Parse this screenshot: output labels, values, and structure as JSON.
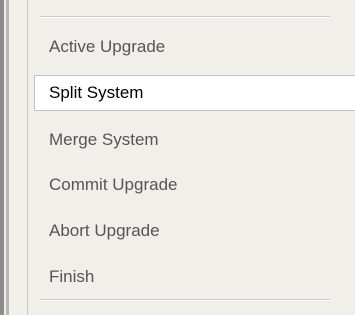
{
  "wizard": {
    "steps": [
      {
        "label": "Active Upgrade",
        "selected": false
      },
      {
        "label": "Split System",
        "selected": true
      },
      {
        "label": "Merge System",
        "selected": false
      },
      {
        "label": "Commit Upgrade",
        "selected": false
      },
      {
        "label": "Abort Upgrade",
        "selected": false
      },
      {
        "label": "Finish",
        "selected": false
      }
    ]
  }
}
